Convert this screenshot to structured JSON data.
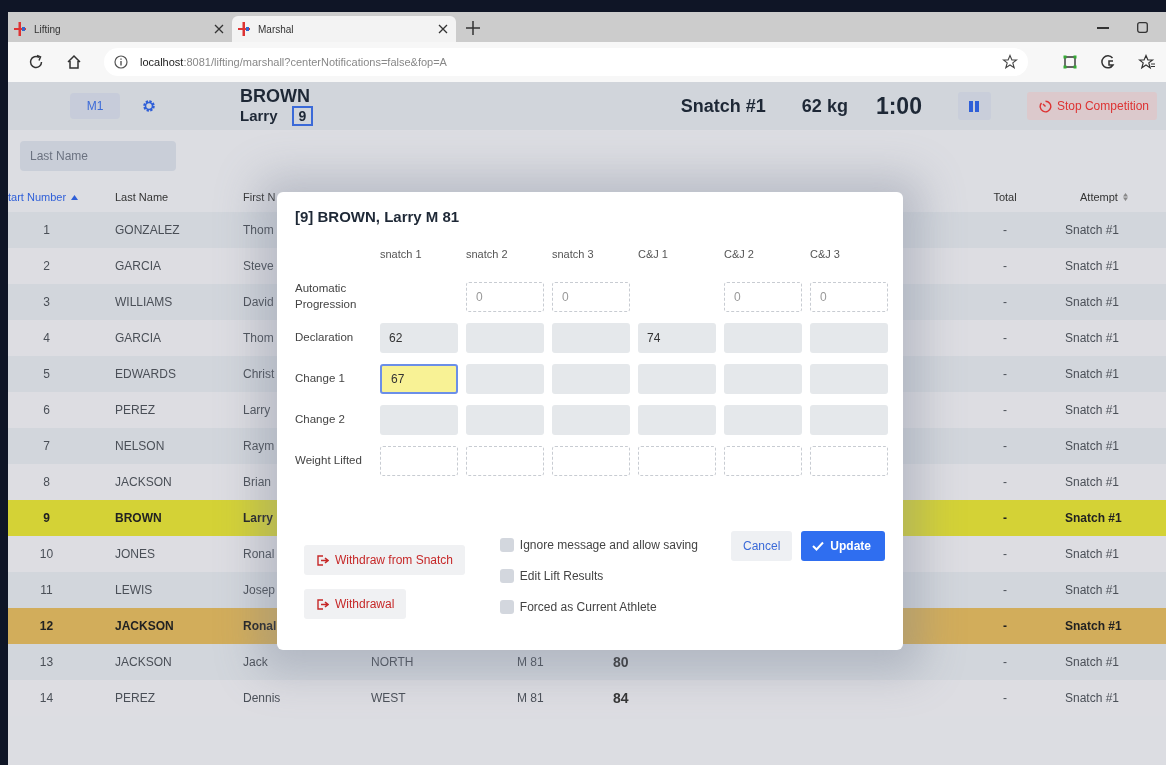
{
  "browser": {
    "tabs": [
      {
        "title": "Lifting",
        "selected": false
      },
      {
        "title": "Marshal",
        "selected": true
      }
    ],
    "url": "**localhost**:8081/lifting/marshall?centerNotifications=false&fop=A"
  },
  "header": {
    "group_button": "M1",
    "last_name": "BROWN",
    "first_name": "Larry",
    "start_number": "9",
    "attempt": "Snatch #1",
    "weight": "62 kg",
    "clock": "1:00",
    "stop_button": "Stop Competition"
  },
  "search": {
    "placeholder": "Last Name"
  },
  "table": {
    "columns": [
      {
        "label": "tart Number",
        "sorted": true
      },
      {
        "label": "Last Name",
        "sorted": false,
        "sortable": false
      },
      {
        "label": "First N",
        "sorted": false,
        "sortable": false
      },
      {
        "label": "Total",
        "sorted": false,
        "sortable": false
      },
      {
        "label": "Attempt",
        "sorted": false,
        "sortable": true
      }
    ],
    "rows": [
      {
        "start": "1",
        "last": "GONZALEZ",
        "first": "Thom",
        "total": "-",
        "attempt": "Snatch #1",
        "current": false,
        "next": false
      },
      {
        "start": "2",
        "last": "GARCIA",
        "first": "Steve",
        "total": "-",
        "attempt": "Snatch #1",
        "current": false,
        "next": false
      },
      {
        "start": "3",
        "last": "WILLIAMS",
        "first": "David",
        "total": "-",
        "attempt": "Snatch #1",
        "current": false,
        "next": false
      },
      {
        "start": "4",
        "last": "GARCIA",
        "first": "Thom",
        "total": "-",
        "attempt": "Snatch #1",
        "current": false,
        "next": false
      },
      {
        "start": "5",
        "last": "EDWARDS",
        "first": "Christ",
        "total": "-",
        "attempt": "Snatch #1",
        "current": false,
        "next": false
      },
      {
        "start": "6",
        "last": "PEREZ",
        "first": "Larry",
        "total": "-",
        "attempt": "Snatch #1",
        "current": false,
        "next": false
      },
      {
        "start": "7",
        "last": "NELSON",
        "first": "Raym",
        "total": "-",
        "attempt": "Snatch #1",
        "current": false,
        "next": false
      },
      {
        "start": "8",
        "last": "JACKSON",
        "first": "Brian",
        "total": "-",
        "attempt": "Snatch #1",
        "current": false,
        "next": false
      },
      {
        "start": "9",
        "last": "BROWN",
        "first": "Larry",
        "total": "-",
        "attempt": "Snatch #1",
        "current": true,
        "next": false
      },
      {
        "start": "10",
        "last": "JONES",
        "first": "Ronal",
        "total": "-",
        "attempt": "Snatch #1",
        "current": false,
        "next": false
      },
      {
        "start": "11",
        "last": "LEWIS",
        "first": "Josep",
        "total": "-",
        "attempt": "Snatch #1",
        "current": false,
        "next": false
      },
      {
        "start": "12",
        "last": "JACKSON",
        "first": "Ronal",
        "total": "-",
        "attempt": "Snatch #1",
        "current": false,
        "next": true
      },
      {
        "start": "13",
        "last": "JACKSON",
        "first": "Jack",
        "team": "NORTH",
        "category": "M 81",
        "entry": "80",
        "total": "-",
        "attempt": "Snatch #1",
        "current": false,
        "next": false
      },
      {
        "start": "14",
        "last": "PEREZ",
        "first": "Dennis",
        "team": "WEST",
        "category": "M 81",
        "entry": "84",
        "total": "-",
        "attempt": "Snatch #1",
        "current": false,
        "next": false
      }
    ]
  },
  "dialog": {
    "title": "[9] BROWN, Larry M 81",
    "columns": [
      "snatch 1",
      "snatch 2",
      "snatch 3",
      "C&J 1",
      "C&J 2",
      "C&J 3"
    ],
    "rows": [
      {
        "label": "Automatic Progression",
        "cells": [
          {
            "kind": "none"
          },
          {
            "kind": "outlined",
            "placeholder": "0"
          },
          {
            "kind": "outlined",
            "placeholder": "0"
          },
          {
            "kind": "none"
          },
          {
            "kind": "outlined",
            "placeholder": "0"
          },
          {
            "kind": "outlined",
            "placeholder": "0"
          }
        ]
      },
      {
        "label": "Declaration",
        "cells": [
          {
            "kind": "filled",
            "value": "62"
          },
          {
            "kind": "filled"
          },
          {
            "kind": "filled"
          },
          {
            "kind": "filled",
            "value": "74"
          },
          {
            "kind": "filled"
          },
          {
            "kind": "filled"
          }
        ]
      },
      {
        "label": "Change 1",
        "cells": [
          {
            "kind": "filled",
            "value": "67",
            "focused": true
          },
          {
            "kind": "filled"
          },
          {
            "kind": "filled"
          },
          {
            "kind": "filled"
          },
          {
            "kind": "filled"
          },
          {
            "kind": "filled"
          }
        ]
      },
      {
        "label": "Change 2",
        "cells": [
          {
            "kind": "filled"
          },
          {
            "kind": "filled"
          },
          {
            "kind": "filled"
          },
          {
            "kind": "filled"
          },
          {
            "kind": "filled"
          },
          {
            "kind": "filled"
          }
        ]
      },
      {
        "label": "Weight Lifted",
        "cells": [
          {
            "kind": "outlined"
          },
          {
            "kind": "outlined"
          },
          {
            "kind": "outlined"
          },
          {
            "kind": "outlined"
          },
          {
            "kind": "outlined"
          },
          {
            "kind": "outlined"
          }
        ]
      }
    ],
    "withdraw_buttons": [
      "Withdraw from Snatch",
      "Withdrawal"
    ],
    "checkboxes": [
      {
        "label": "Ignore message and allow saving",
        "checked": false
      },
      {
        "label": "Edit Lift Results",
        "checked": false
      },
      {
        "label": "Forced as Current Athlete",
        "checked": false
      }
    ],
    "cancel_button": "Cancel",
    "update_button": "Update"
  }
}
